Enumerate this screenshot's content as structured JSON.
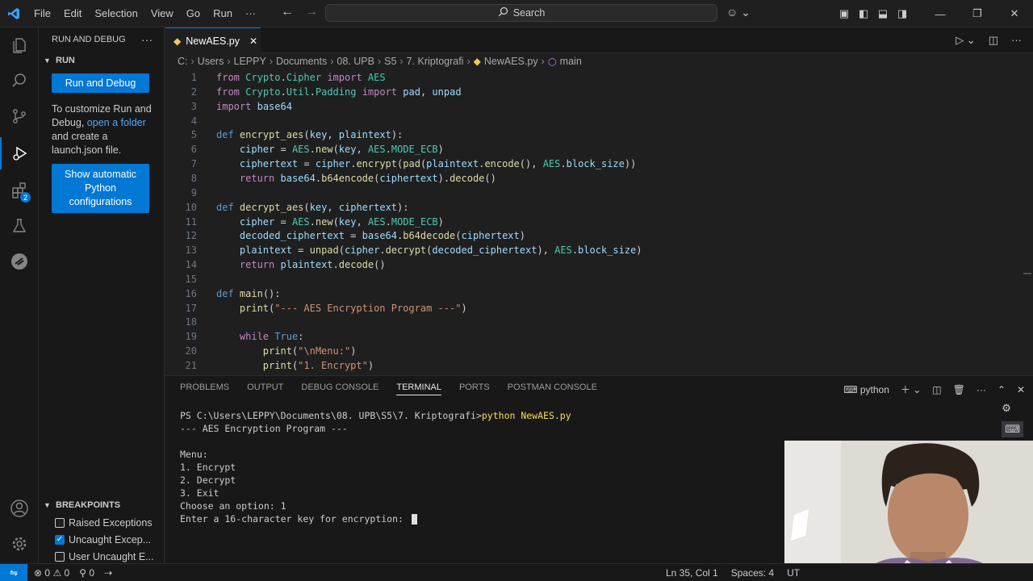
{
  "titlebar": {
    "menus": [
      "File",
      "Edit",
      "Selection",
      "View",
      "Go",
      "Run",
      "···"
    ],
    "search_label": "Search"
  },
  "sidebar": {
    "title": "RUN AND DEBUG",
    "more": "···",
    "run_section": "RUN",
    "run_debug_button": "Run and Debug",
    "text_1": "To customize Run and Debug,",
    "open_folder_link": "open a folder",
    "text_2": "and create a launch.json file.",
    "auto_python_button": "Show automatic Python configurations",
    "breakpoints_section": "BREAKPOINTS",
    "breakpoints": [
      {
        "label": "Raised Exceptions",
        "checked": false
      },
      {
        "label": "Uncaught Excep...",
        "checked": true
      },
      {
        "label": "User Uncaught E...",
        "checked": false
      }
    ]
  },
  "activity_badge": "2",
  "editor": {
    "tab_label": "NewAES.py",
    "breadcrumb": [
      "C:",
      "Users",
      "LEPPY",
      "Documents",
      "08. UPB",
      "S5",
      "7. Kriptografi",
      "NewAES.py",
      "main"
    ]
  },
  "code_lines": [
    "from Crypto.Cipher import AES",
    "from Crypto.Util.Padding import pad, unpad",
    "import base64",
    "",
    "def encrypt_aes(key, plaintext):",
    "    cipher = AES.new(key, AES.MODE_ECB)",
    "    ciphertext = cipher.encrypt(pad(plaintext.encode(), AES.block_size))",
    "    return base64.b64encode(ciphertext).decode()",
    "",
    "def decrypt_aes(key, ciphertext):",
    "    cipher = AES.new(key, AES.MODE_ECB)",
    "    decoded_ciphertext = base64.b64decode(ciphertext)",
    "    plaintext = unpad(cipher.decrypt(decoded_ciphertext), AES.block_size)",
    "    return plaintext.decode()",
    "",
    "def main():",
    "    print(\"--- AES Encryption Program ---\")",
    "",
    "    while True:",
    "        print(\"\\nMenu:\")",
    "        print(\"1. Encrypt\")"
  ],
  "panel": {
    "tabs": [
      "PROBLEMS",
      "OUTPUT",
      "DEBUG CONSOLE",
      "TERMINAL",
      "PORTS",
      "POSTMAN CONSOLE"
    ],
    "active_tab": "TERMINAL",
    "shell_label": "python",
    "terminal": {
      "prompt": "PS C:\\Users\\LEPPY\\Documents\\08. UPB\\S5\\7. Kriptografi>",
      "command": "python NewAES.py",
      "lines": [
        "--- AES Encryption Program ---",
        "",
        "Menu:",
        "1. Encrypt",
        "2. Decrypt",
        "3. Exit",
        "Choose an option: 1",
        "Enter a 16-character key for encryption: "
      ]
    }
  },
  "statusbar": {
    "errors": "0",
    "warnings": "0",
    "ports": "0",
    "position": "Ln 35, Col 1",
    "spaces": "Spaces: 4",
    "encoding": "UT"
  },
  "colors": {
    "accent": "#0078d4",
    "background": "#1f1f1f"
  }
}
